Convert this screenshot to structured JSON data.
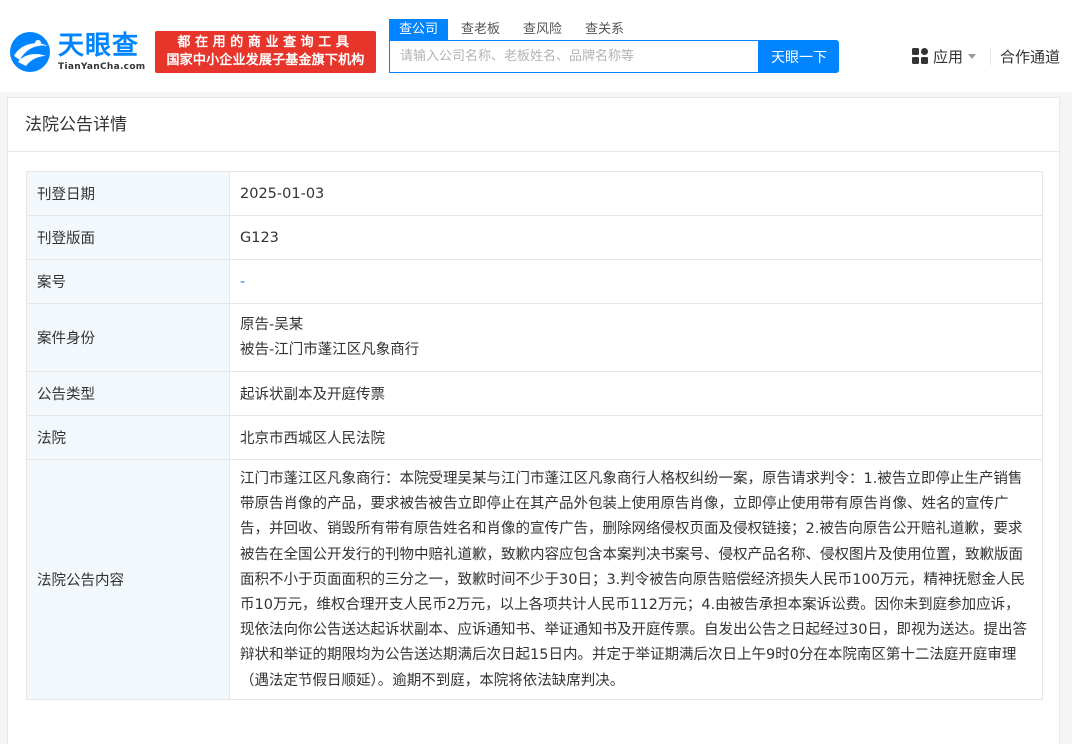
{
  "header": {
    "logo": {
      "name": "天眼查",
      "domain": "TianYanCha.com"
    },
    "slogan": {
      "line1": "都在用的商业查询工具",
      "line2": "国家中小企业发展子基金旗下机构"
    },
    "search_tabs": [
      {
        "label": "查公司",
        "active": true
      },
      {
        "label": "查老板",
        "active": false
      },
      {
        "label": "查风险",
        "active": false
      },
      {
        "label": "查关系",
        "active": false
      }
    ],
    "search": {
      "placeholder": "请输入公司名称、老板姓名、品牌名称等",
      "button": "天眼一下"
    },
    "nav": {
      "apps": "应用",
      "partner": "合作通道"
    },
    "colors": {
      "brand": "#0084ff",
      "slogan_bg": "#e8352b"
    }
  },
  "card": {
    "title": "法院公告详情",
    "rows": [
      {
        "label": "刊登日期",
        "value": "2025-01-03"
      },
      {
        "label": "刊登版面",
        "value": "G123"
      },
      {
        "label": "案号",
        "value": "-"
      },
      {
        "label": "案件身份",
        "value_lines": [
          "原告-吴某",
          "被告-江门市蓬江区凡象商行"
        ]
      },
      {
        "label": "公告类型",
        "value": "起诉状副本及开庭传票"
      },
      {
        "label": "法院",
        "value": "北京市西城区人民法院"
      },
      {
        "label": "法院公告内容",
        "value": "江门市蓬江区凡象商行：本院受理吴某与江门市蓬江区凡象商行人格权纠纷一案，原告请求判令：1.被告立即停止生产销售带原告肖像的产品，要求被告被告立即停止在其产品外包装上使用原告肖像，立即停止使用带有原告肖像、姓名的宣传广告，并回收、销毁所有带有原告姓名和肖像的宣传广告，删除网络侵权页面及侵权链接；2.被告向原告公开赔礼道歉，要求被告在全国公开发行的刊物中赔礼道歉，致歉内容应包含本案判决书案号、侵权产品名称、侵权图片及使用位置，致歉版面面积不小于页面面积的三分之一，致歉时间不少于30日；3.判令被告向原告赔偿经济损失人民币100万元，精神抚慰金人民币10万元，维权合理开支人民币2万元，以上各项共计人民币112万元；4.由被告承担本案诉讼费。因你未到庭参加应诉，现依法向你公告送达起诉状副本、应诉通知书、举证通知书及开庭传票。自发出公告之日起经过30日，即视为送达。提出答辩状和举证的期限均为公告送达期满后次日起15日内。并定于举证期满后次日上午9时0分在本院南区第十二法庭开庭审理（遇法定节假日顺延）。逾期不到庭，本院将依法缺席判决。"
      }
    ]
  }
}
